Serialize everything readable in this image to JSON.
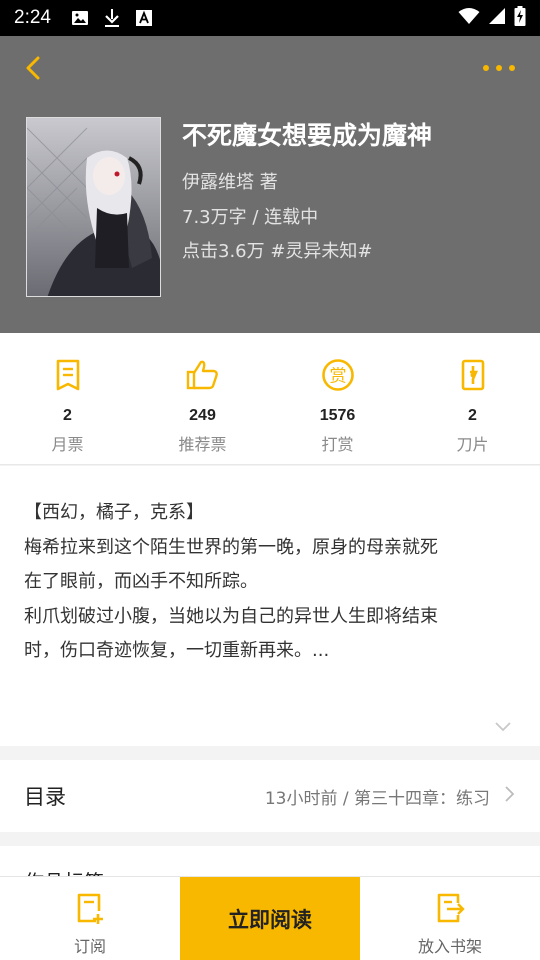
{
  "status_bar": {
    "time": "2:24"
  },
  "book": {
    "title": "不死魔女想要成为魔神",
    "author": "伊露维塔 著",
    "info": "7.3万字 / 连载中",
    "tags": "点击3.6万 #灵异未知#"
  },
  "stats": [
    {
      "value": "2",
      "label": "月票",
      "icon": "ticket-icon"
    },
    {
      "value": "249",
      "label": "推荐票",
      "icon": "thumbs-up-icon"
    },
    {
      "value": "1576",
      "label": "打赏",
      "icon": "reward-coin-icon"
    },
    {
      "value": "2",
      "label": "刀片",
      "icon": "blade-icon"
    }
  ],
  "intro": {
    "lines": [
      "【西幻，橘子，克系】",
      "梅希拉来到这个陌生世界的第一晚，原身的母亲就死",
      "在了眼前，而凶手不知所踪。",
      "利爪划破过小腹，当她以为自己的异世人生即将结束",
      "时，伤口奇迹恢复，一切重新再来。..."
    ]
  },
  "catalog": {
    "label": "目录",
    "latest": "13小时前 / 第三十四章：练习"
  },
  "works_section": {
    "label": "作品标签"
  },
  "bottom_bar": {
    "subscribe": "订阅",
    "read_now": "立即阅读",
    "add_shelf": "放入书架"
  },
  "colors": {
    "accent": "#f8b800",
    "header_bg": "#6e6e6e"
  }
}
